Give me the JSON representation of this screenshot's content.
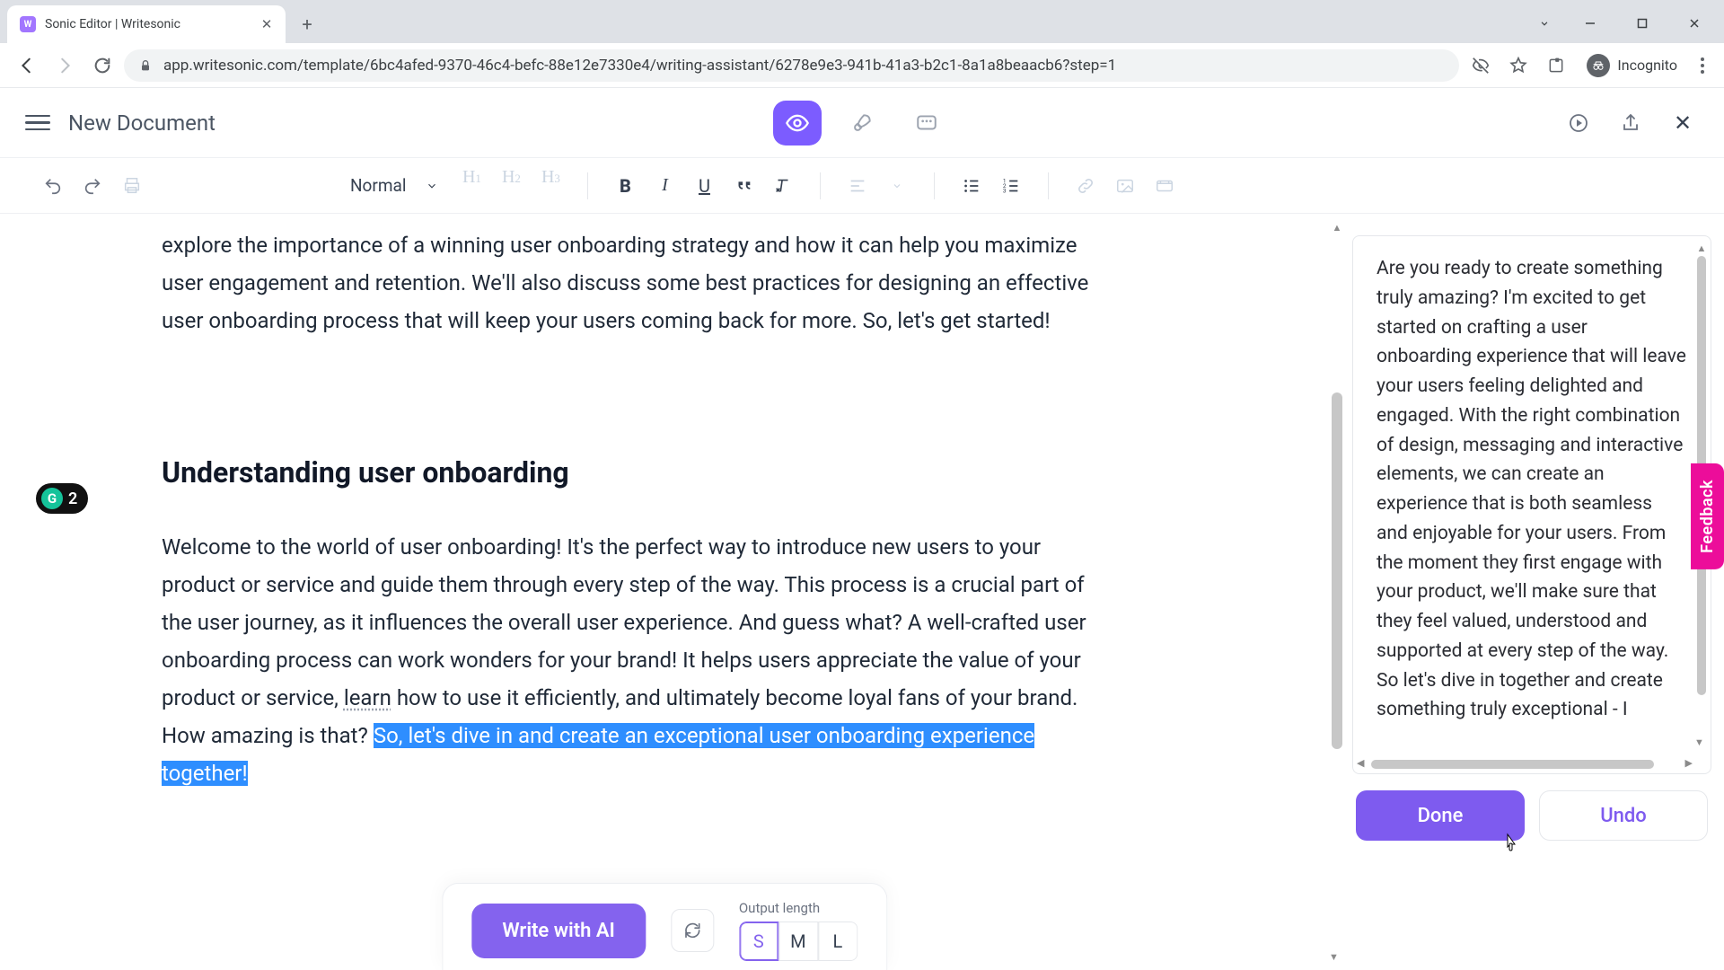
{
  "browser": {
    "tab_title": "Sonic Editor | Writesonic",
    "url": "app.writesonic.com/template/6bc4afed-9370-46c4-befc-88e12e7330e4/writing-assistant/6278e9e3-941b-41a3-b2c1-8a1a8beaacb6?step=1",
    "incognito_label": "Incognito"
  },
  "header": {
    "doc_title": "New Document"
  },
  "toolbar": {
    "style_select": "Normal",
    "h1": "H₁",
    "h2": "H₂",
    "h3": "H₃"
  },
  "editor": {
    "para1": "explore the importance of a winning user onboarding strategy and how it can help you maximize user engagement and retention. We'll also discuss some best practices for designing an effective user onboarding process that will keep your users coming back for more. So, let's get started!",
    "heading": "Understanding user onboarding",
    "para2_a": "Welcome to the world of user onboarding! It's the perfect way to introduce new users to your product or service and guide them through every step of the way. This process is a crucial part of the user journey, as it influences the overall user experience. And guess what? A well-crafted user onboarding process can work wonders for your brand! It helps users appreciate the value of your product or service, ",
    "para2_learn": "learn",
    "para2_b": " how to use it efficiently, and ultimately become loyal fans of your brand. How amazing is that? ",
    "para2_sel": "So, let's dive in and create an exceptional user onboarding experience together!",
    "grammar_count": "2"
  },
  "ai_panel": {
    "text": "Are you ready to create something truly amazing? I'm excited to get started on crafting a user onboarding experience that will leave your users feeling delighted and engaged. With the right combination of design, messaging and interactive elements, we can create an experience that is both seamless and enjoyable for your users. From the moment they first engage with your product, we'll make sure that they feel valued, understood and supported at every step of the way. So let's dive in together and create something truly exceptional - I",
    "done": "Done",
    "undo": "Undo"
  },
  "bottom": {
    "write_ai": "Write with AI",
    "output_length_label": "Output length",
    "s": "S",
    "m": "M",
    "l": "L"
  },
  "feedback": "Feedback"
}
